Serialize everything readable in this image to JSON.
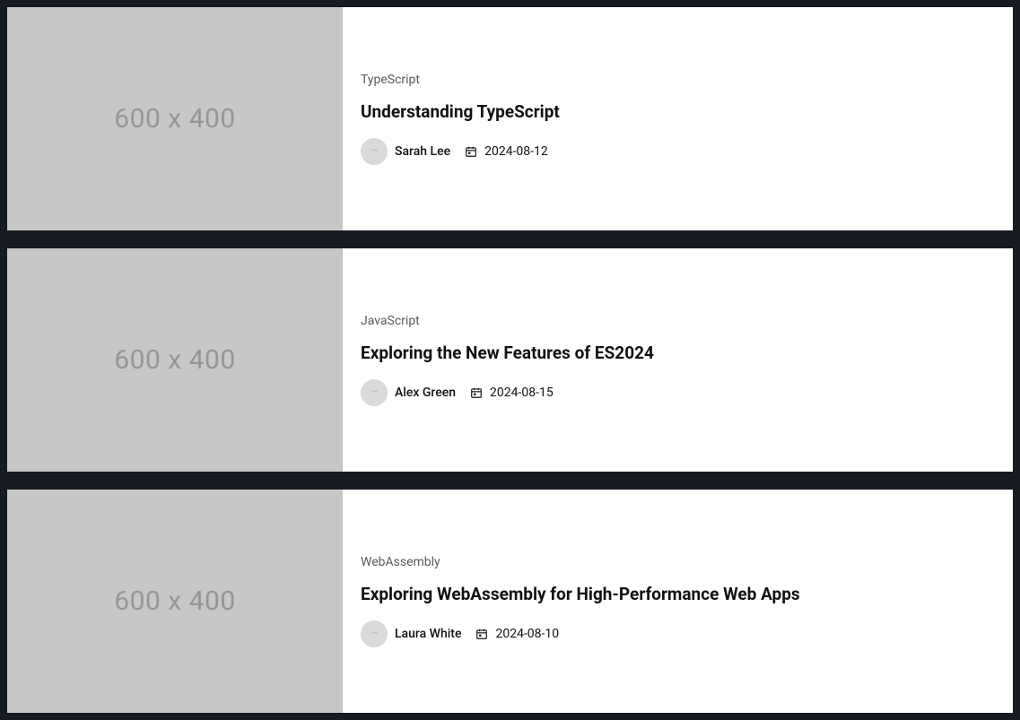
{
  "image_placeholder": "600 x 400",
  "posts": [
    {
      "category": "TypeScript",
      "title": "Understanding TypeScript",
      "author": "Sarah Lee",
      "date": "2024-08-12"
    },
    {
      "category": "JavaScript",
      "title": "Exploring the New Features of ES2024",
      "author": "Alex Green",
      "date": "2024-08-15"
    },
    {
      "category": "WebAssembly",
      "title": "Exploring WebAssembly for High-Performance Web Apps",
      "author": "Laura White",
      "date": "2024-08-10"
    }
  ]
}
